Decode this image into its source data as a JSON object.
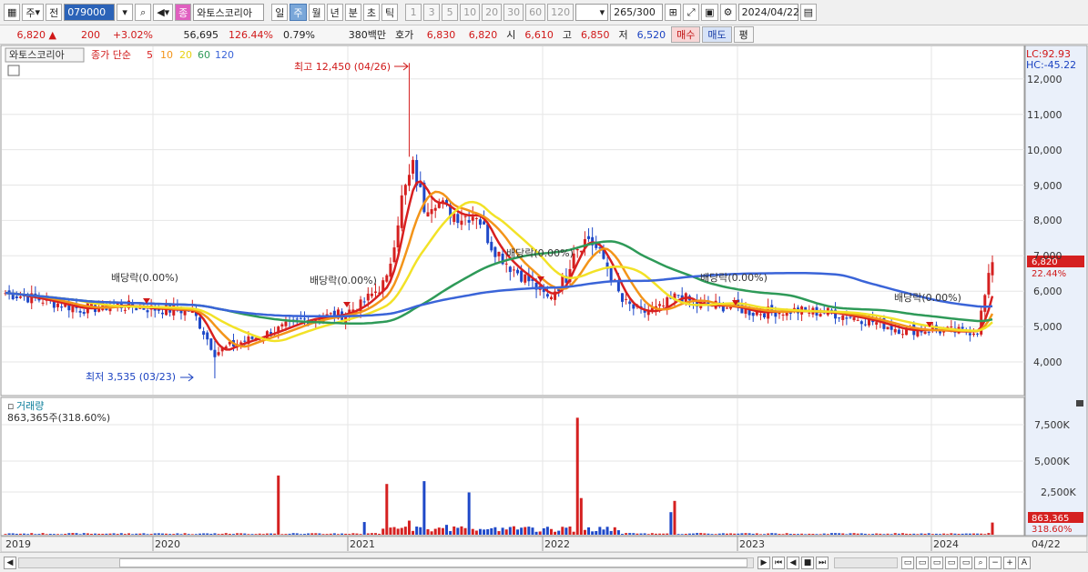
{
  "toolbar1": {
    "mode_label": "주",
    "jeon_label": "전",
    "code_value": "079000",
    "stock_badge": "종",
    "stock_name": "와토스코리아",
    "periods": [
      "일",
      "주",
      "월",
      "년",
      "분",
      "초",
      "틱"
    ],
    "period_selected": "주",
    "intervals": [
      "1",
      "3",
      "5",
      "10",
      "20",
      "30",
      "60",
      "120"
    ],
    "count_value": "265",
    "count_total": "/300",
    "date_value": "2024/04/22"
  },
  "toolbar2": {
    "price": "6,820",
    "change": "200",
    "change_pct": "+3.02%",
    "volume": "56,695",
    "volume_ratio": "126.44%",
    "turnover": "0.79%",
    "amount": "380백만",
    "hoga_label": "호가",
    "ask": "6,830",
    "bid": "6,820",
    "open_label": "시",
    "open": "6,610",
    "high_label": "고",
    "high": "6,850",
    "low_label": "저",
    "low": "6,520",
    "buy_label": "매수",
    "sell_label": "매도",
    "eval_label": "평"
  },
  "chart": {
    "stock_name": "와토스코리아",
    "legend_prefix": "종가 단순",
    "ma_periods": [
      "5",
      "10",
      "20",
      "60",
      "120"
    ],
    "lc_text": "LC:92.93",
    "hc_text": "HC:-45.22",
    "max_note": "최고 12,450 (04/26)",
    "min_note": "최저 3,535 (03/23)",
    "dividend_note": "배당락(0.00%)",
    "price_badge": "6,820",
    "pct_badge": "22.44%",
    "volume_label": "거래량",
    "volume_value": "863,365주(318.60%)",
    "vol_badge": "863,365",
    "vol_pct_badge": "318.60%",
    "last_date": "04/22",
    "colors": {
      "up": "#d52020",
      "down": "#1e48c8",
      "ma5": "#d82020",
      "ma10": "#f39419",
      "ma20": "#f2e227",
      "ma60": "#2e9a58",
      "ma120": "#3a64d8"
    }
  },
  "chart_data": {
    "type": "candlestick",
    "x_labels": [
      "2019",
      "2020",
      "2021",
      "2022",
      "2023",
      "2024"
    ],
    "y_ticks": [
      "4,000",
      "5,000",
      "6,000",
      "7,000",
      "8,000",
      "9,000",
      "10,000",
      "11,000",
      "12,000"
    ],
    "volume_ticks": [
      "2,500K",
      "5,000K",
      "7,500K"
    ],
    "series": [
      {
        "name": "close",
        "points": [
          [
            0,
            5950
          ],
          [
            10,
            5750
          ],
          [
            20,
            5500
          ],
          [
            30,
            5600
          ],
          [
            40,
            5500
          ],
          [
            50,
            5450
          ],
          [
            56,
            4250
          ],
          [
            60,
            4450
          ],
          [
            70,
            4800
          ],
          [
            80,
            5200
          ],
          [
            90,
            5350
          ],
          [
            95,
            5600
          ],
          [
            102,
            6300
          ],
          [
            106,
            8600
          ],
          [
            109,
            9500
          ],
          [
            112,
            8400
          ],
          [
            115,
            8600
          ],
          [
            118,
            8300
          ],
          [
            122,
            8100
          ],
          [
            126,
            8200
          ],
          [
            130,
            7300
          ],
          [
            135,
            6700
          ],
          [
            140,
            6300
          ],
          [
            145,
            5800
          ],
          [
            150,
            6400
          ],
          [
            152,
            7200
          ],
          [
            156,
            7500
          ],
          [
            160,
            6900
          ],
          [
            165,
            5700
          ],
          [
            170,
            5400
          ],
          [
            175,
            5500
          ],
          [
            180,
            5900
          ],
          [
            185,
            5600
          ],
          [
            190,
            5600
          ],
          [
            195,
            5550
          ],
          [
            200,
            5400
          ],
          [
            210,
            5450
          ],
          [
            220,
            5400
          ],
          [
            230,
            5200
          ],
          [
            240,
            4900
          ],
          [
            248,
            4900
          ],
          [
            256,
            4850
          ],
          [
            260,
            4900
          ],
          [
            264,
            6820
          ]
        ]
      },
      {
        "name": "5",
        "values": "ma5"
      },
      {
        "name": "10",
        "values": "ma10"
      },
      {
        "name": "20",
        "values": "ma20"
      },
      {
        "name": "60",
        "values": "ma60"
      },
      {
        "name": "120",
        "values": "ma120"
      }
    ],
    "max": {
      "value": 12450,
      "date": "04/26"
    },
    "min": {
      "value": 3535,
      "date": "03/23"
    }
  }
}
